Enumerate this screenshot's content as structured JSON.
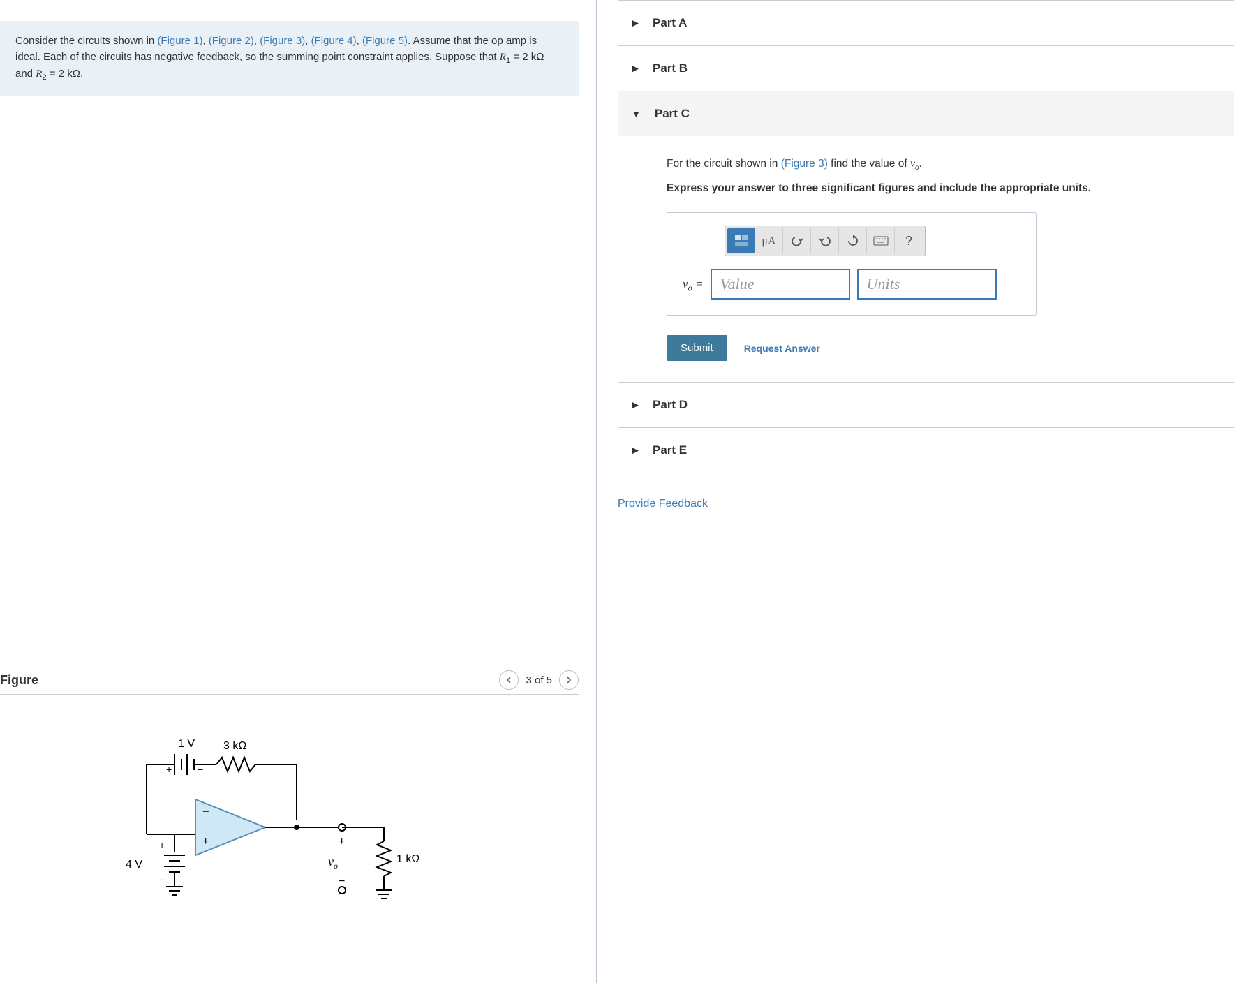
{
  "problem": {
    "intro": "Consider the circuits shown in",
    "links": [
      "(Figure 1)",
      "(Figure 2)",
      "(Figure 3)",
      "(Figure 4)",
      "(Figure 5)"
    ],
    "body1": ". Assume that the op amp is ideal. Each of the circuits has negative feedback, so the summing point constraint applies. Suppose that ",
    "r1_sym": "R",
    "r1_sub": "1",
    "r1_val": " = 2 kΩ and ",
    "r2_sym": "R",
    "r2_sub": "2",
    "r2_val": " = 2 kΩ."
  },
  "figure": {
    "title": "Figure",
    "pager": "3 of 5",
    "labels": {
      "v1": "1 V",
      "r1": "3 kΩ",
      "v2": "4 V",
      "vo": "v",
      "vo_sub": "o",
      "rload": "1 kΩ",
      "plus": "+",
      "minus": "−"
    }
  },
  "parts": {
    "a": "Part A",
    "b": "Part B",
    "c": "Part C",
    "d": "Part D",
    "e": "Part E"
  },
  "partC": {
    "prompt_pre": "For the circuit shown in ",
    "prompt_link": "(Figure 3)",
    "prompt_post": " find the value of ",
    "vo": "v",
    "vo_sub": "o",
    "prompt_end": ".",
    "hint": "Express your answer to three significant figures and include the appropriate units.",
    "units_btn": "μA",
    "help": "?",
    "vo_label_pre": "v",
    "vo_label_sub": "o",
    "vo_label_post": " = ",
    "value_ph": "Value",
    "units_ph": "Units",
    "submit": "Submit",
    "request": "Request Answer"
  },
  "feedback": "Provide Feedback"
}
